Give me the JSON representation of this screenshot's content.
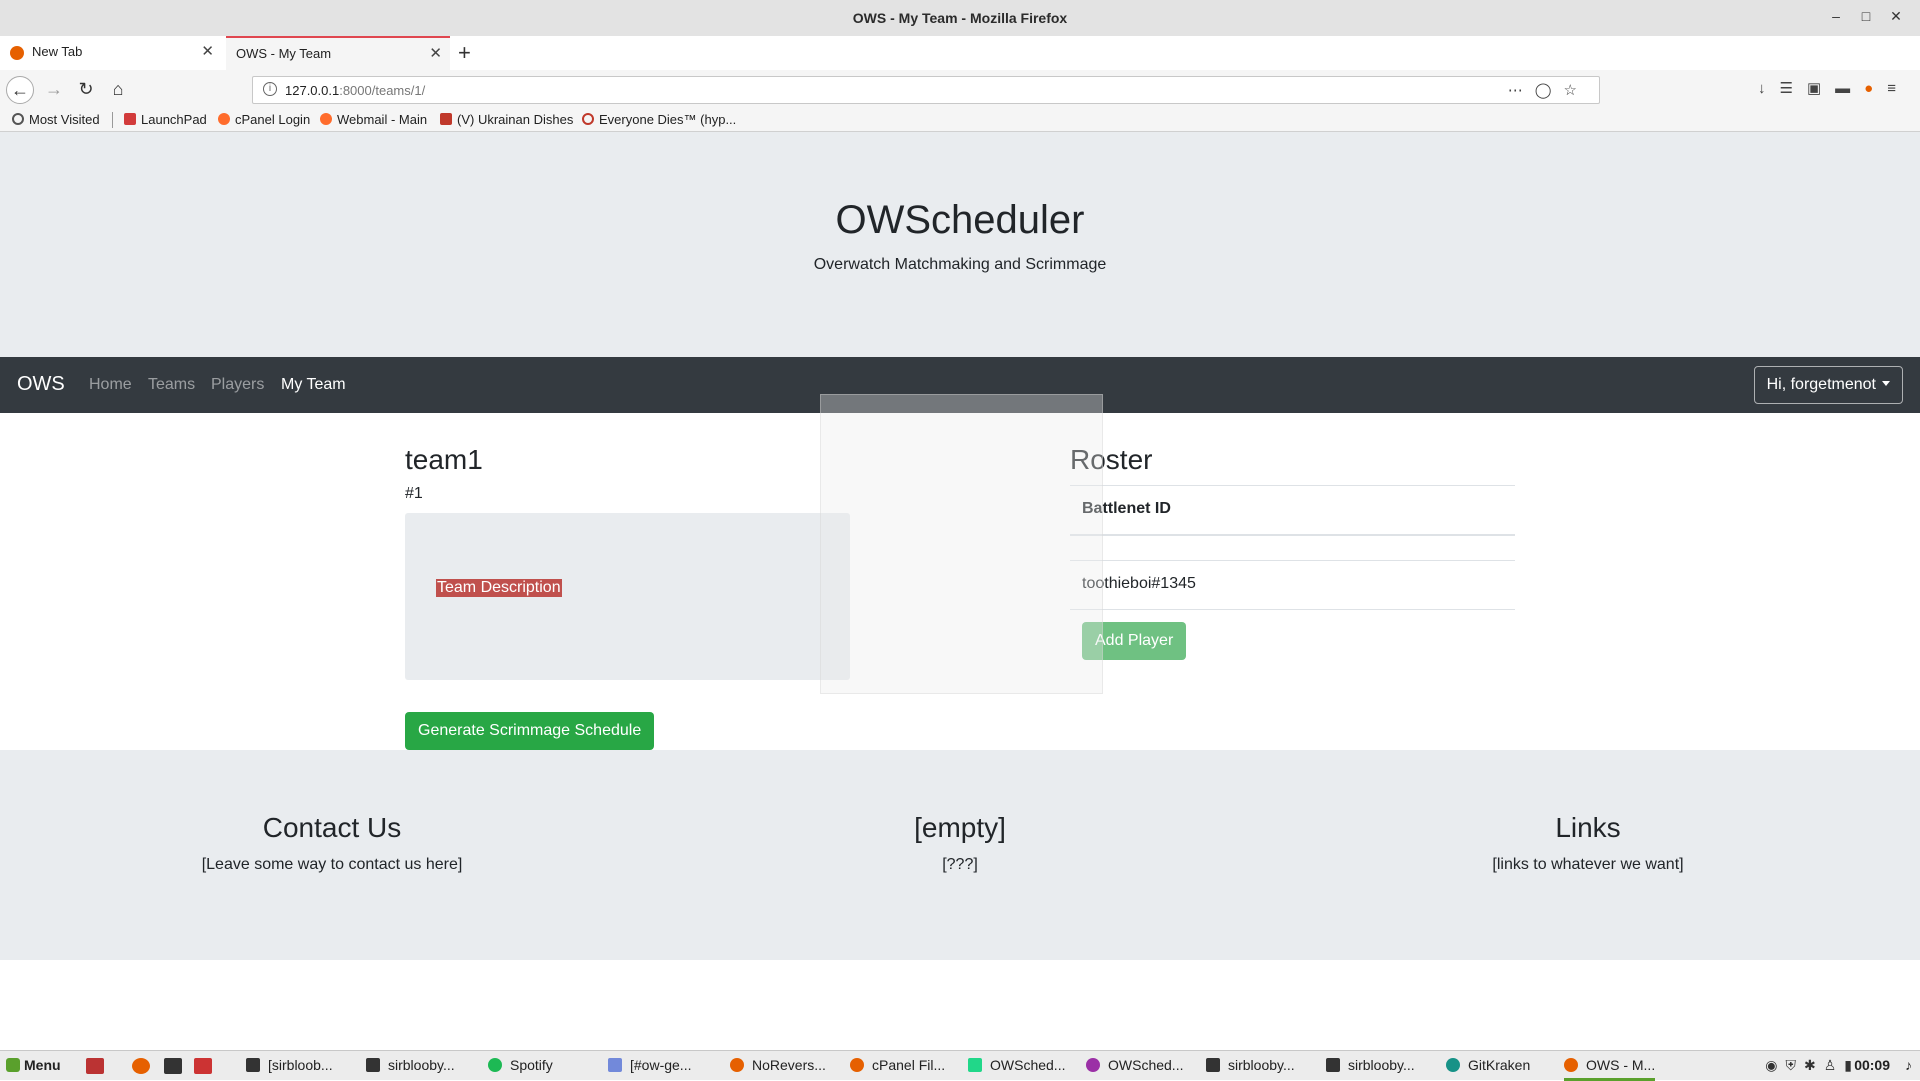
{
  "window": {
    "title": "OWS - My Team - Mozilla Firefox"
  },
  "tabs": [
    {
      "label": "New Tab"
    },
    {
      "label": "OWS - My Team"
    }
  ],
  "url": {
    "host": "127.0.0.1",
    "rest": ":8000/teams/1/"
  },
  "bookmarks": [
    "Most Visited",
    "LaunchPad",
    "cPanel Login",
    "Webmail - Main",
    "(V) Ukrainan Dishes",
    "Everyone Dies™ (hyp..."
  ],
  "site": {
    "title": "OWScheduler",
    "subtitle": "Overwatch Matchmaking and Scrimmage",
    "nav": {
      "brand": "OWS",
      "links": [
        "Home",
        "Teams",
        "Players",
        "My Team"
      ],
      "active": "My Team",
      "user_menu": "Hi, forgetmenot"
    },
    "team": {
      "name": "team1",
      "number": "#1",
      "description": "Team Description",
      "generate_button": "Generate Scrimmage Schedule"
    },
    "roster": {
      "title": "Roster",
      "column": "Battlenet ID",
      "players": [
        "toothieboi#1345"
      ],
      "add_button": "Add Player"
    },
    "footer": [
      {
        "heading": "Contact Us",
        "text": "[Leave some way to contact us here]"
      },
      {
        "heading": "[empty]",
        "text": "[???]"
      },
      {
        "heading": "Links",
        "text": "[links to whatever we want]"
      }
    ]
  },
  "taskbar": {
    "menu": "Menu",
    "items": [
      "[sirbloob...",
      "sirblooby...",
      "Spotify",
      "[#ow-ge...",
      "NoRevers...",
      "cPanel Fil...",
      "OWSched...",
      "OWSched...",
      "sirblooby...",
      "sirblooby...",
      "GitKraken",
      "OWS - M..."
    ],
    "clock": "00:09"
  }
}
